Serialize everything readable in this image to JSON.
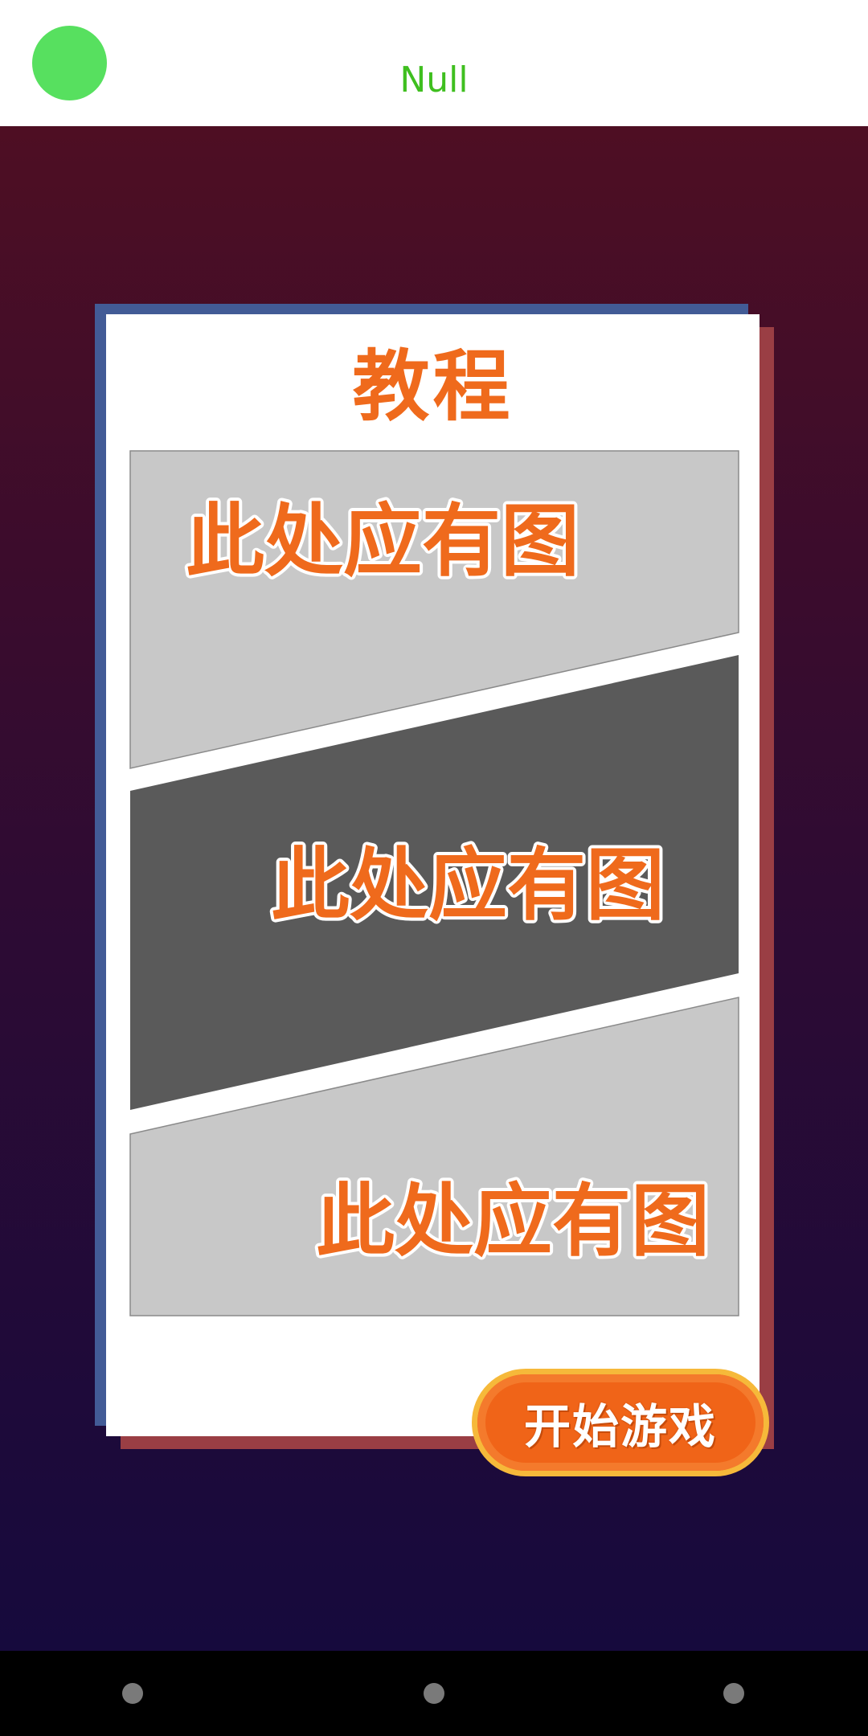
{
  "header": {
    "title": "Null",
    "title_color": "#3fbf1f",
    "avatar_color": "#57e05f"
  },
  "card": {
    "title": "教程",
    "accent_color": "#ef6a1c",
    "shadow_blue": "#425b96",
    "shadow_red": "#9a3e44",
    "panels": [
      {
        "label": "此处应有图",
        "fill": "#c8c8c8"
      },
      {
        "label": "此处应有图",
        "fill": "#5a5a5a"
      },
      {
        "label": "此处应有图",
        "fill": "#c8c8c8"
      }
    ]
  },
  "start_button": {
    "label": "开始游戏"
  },
  "navbar": {
    "buttons": [
      "back-icon",
      "home-icon",
      "recents-icon"
    ]
  }
}
